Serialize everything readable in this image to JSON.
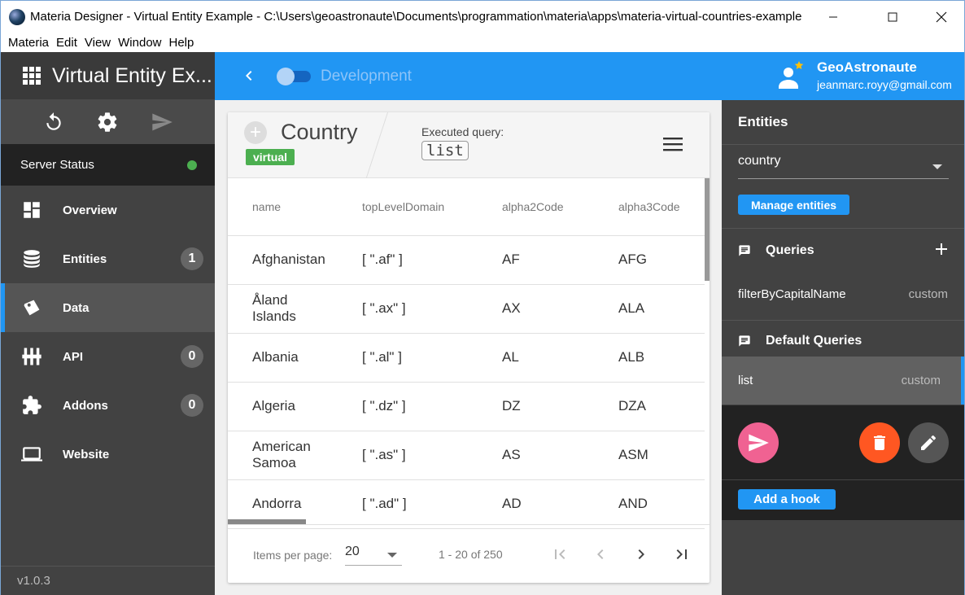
{
  "window": {
    "title": "Materia Designer - Virtual Entity Example - C:\\Users\\geoastronaute\\Documents\\programmation\\materia\\apps\\materia-virtual-countries-example",
    "menu": [
      "Materia",
      "Edit",
      "View",
      "Window",
      "Help"
    ]
  },
  "sidebar": {
    "app_title": "Virtual Entity Ex...",
    "server_status": "Server Status",
    "server_status_color": "#4caf50",
    "items": [
      {
        "label": "Overview",
        "icon": "dashboard-icon",
        "badge": null,
        "active": false
      },
      {
        "label": "Entities",
        "icon": "database-icon",
        "badge": "1",
        "active": false
      },
      {
        "label": "Data",
        "icon": "tag-icon",
        "badge": null,
        "active": true
      },
      {
        "label": "API",
        "icon": "api-icon",
        "badge": "0",
        "active": false
      },
      {
        "label": "Addons",
        "icon": "puzzle-icon",
        "badge": "0",
        "active": false
      },
      {
        "label": "Website",
        "icon": "laptop-icon",
        "badge": null,
        "active": false
      }
    ],
    "version": "v1.0.3"
  },
  "topbar": {
    "environment": "Development",
    "user_name": "GeoAstronaute",
    "user_email": "jeanmarc.royy@gmail.com",
    "accent": "#2196f3"
  },
  "card": {
    "entity_name": "Country",
    "entity_badge": "virtual",
    "executed_query_label": "Executed query:",
    "executed_query_value": "list",
    "columns": [
      "name",
      "topLevelDomain",
      "alpha2Code",
      "alpha3Code"
    ],
    "rows": [
      [
        "Afghanistan",
        "[ \".af\" ]",
        "AF",
        "AFG"
      ],
      [
        "Åland Islands",
        "[ \".ax\" ]",
        "AX",
        "ALA"
      ],
      [
        "Albania",
        "[ \".al\" ]",
        "AL",
        "ALB"
      ],
      [
        "Algeria",
        "[ \".dz\" ]",
        "DZ",
        "DZA"
      ],
      [
        "American Samoa",
        "[ \".as\" ]",
        "AS",
        "ASM"
      ],
      [
        "Andorra",
        "[ \".ad\" ]",
        "AD",
        "AND"
      ]
    ],
    "paginator": {
      "items_per_page_label": "Items per page:",
      "items_per_page": "20",
      "range": "1 - 20 of 250"
    }
  },
  "rpanel": {
    "title": "Entities",
    "entity_select": "country",
    "manage_label": "Manage entities",
    "queries_label": "Queries",
    "queries": [
      {
        "name": "filterByCapitalName",
        "type": "custom"
      }
    ],
    "default_queries_label": "Default Queries",
    "default_queries": [
      {
        "name": "list",
        "type": "custom"
      }
    ],
    "add_hook_label": "Add a hook",
    "colors": {
      "run": "#f06292",
      "delete": "#ff5722",
      "edit": "#555555"
    }
  }
}
